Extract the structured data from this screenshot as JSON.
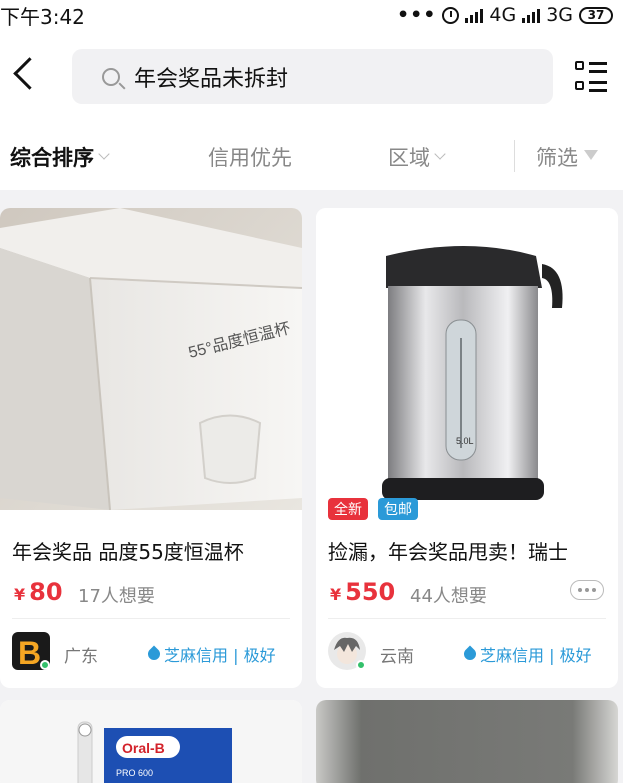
{
  "status_bar": {
    "time": "下午3:42",
    "network1": "4G",
    "network2": "3G",
    "battery": "37"
  },
  "search": {
    "value": "年会奖品未拆封"
  },
  "filters": {
    "sort": "综合排序",
    "credit": "信用优先",
    "region": "区域",
    "filter": "筛选"
  },
  "items": [
    {
      "title": "年会奖品 品度55度恒温杯",
      "price": "80",
      "currency": "¥",
      "wants": "17人想要",
      "location": "广东",
      "credit": "芝麻信用 | 极好",
      "box_text": "55°品度恒温杯",
      "tags": []
    },
    {
      "title": "捡漏，年会奖品甩卖！瑞士",
      "price": "550",
      "currency": "¥",
      "wants": "44人想要",
      "location": "云南",
      "credit": "芝麻信用 | 极好",
      "tags": [
        "全新",
        "包邮"
      ],
      "kettle_label": "5.0L"
    },
    {
      "box_brand": "Oral-B",
      "box_model": "PRO 600"
    },
    {}
  ],
  "colors": {
    "price_red": "#e8323c",
    "credit_blue": "#2b9ad8",
    "tag_new": "#e8323c",
    "tag_ship": "#2b9ad8"
  }
}
